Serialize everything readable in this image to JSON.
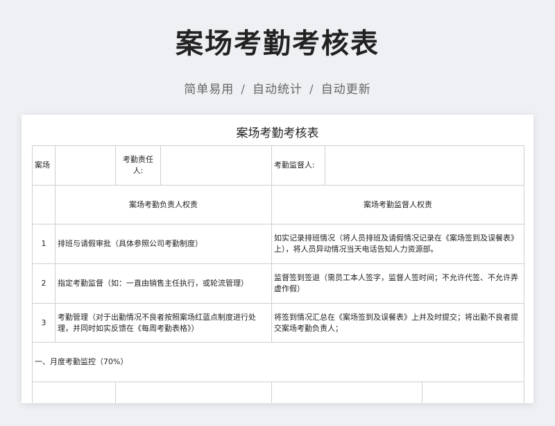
{
  "hero": {
    "title": "案场考勤考核表",
    "subtitle_parts": [
      "简单易用",
      "自动统计",
      "自动更新"
    ],
    "separator": "/"
  },
  "sheet": {
    "title": "案场考勤考核表",
    "header_row": {
      "site_label": "案场",
      "attendance_owner_label": "考勤责任人:",
      "attendance_supervisor_label": "考勤监督人:"
    },
    "rights_header": {
      "owner_rights": "案场考勤负责人权责",
      "supervisor_rights": "案场考勤监督人权责"
    },
    "rows": [
      {
        "no": "1",
        "owner": "排班与请假审批（具体参照公司考勤制度）",
        "supervisor": "如实记录排班情况（将人员排班及请假情况记录在《案场签到及误餐表》上），将人员异动情况当天电话告知人力资源部。"
      },
      {
        "no": "2",
        "owner": "指定考勤监督（如：一直由销售主任执行，或轮流管理）",
        "supervisor": "监督签到签退（需员工本人签字，监督人签时间；不允许代签、不允许弄虚作假）"
      },
      {
        "no": "3",
        "owner": "考勤管理（对于出勤情况不良者按照案场红蓝点制度进行处理，并同时如实反馈在《每周考勤表格》）",
        "supervisor": "将签到情况汇总在《案场签到及误餐表》上并及时提交；将出勤不良者提交案场考勤负责人；"
      }
    ],
    "section_title": "一、月度考勤监控（70%）"
  }
}
